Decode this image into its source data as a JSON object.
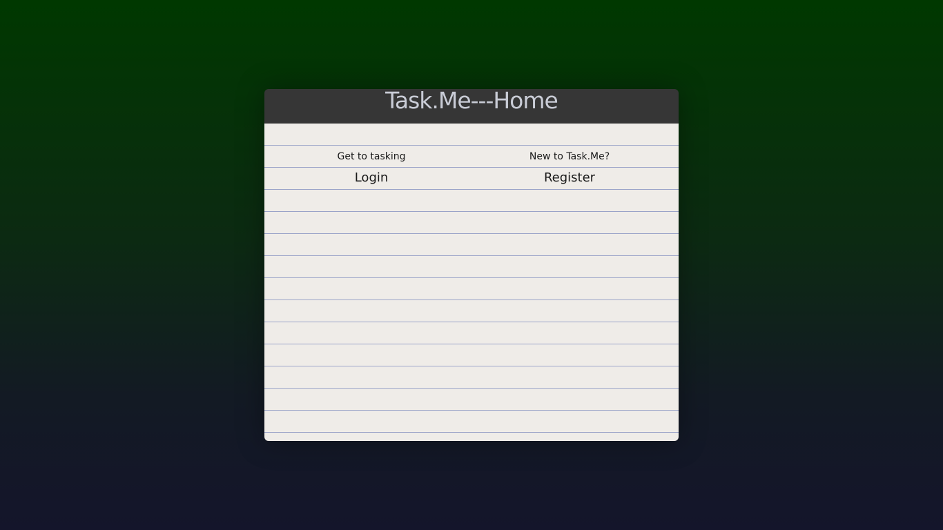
{
  "header": {
    "title": "Task.Me---Home"
  },
  "login_section": {
    "caption": "Get to tasking",
    "link_label": "Login"
  },
  "register_section": {
    "caption": "New to Task.Me?",
    "link_label": "Register"
  },
  "colors": {
    "page_gradient_top": "#003800",
    "page_gradient_bottom": "#14152b",
    "header_background": "#363636",
    "header_text": "#c9ccd6",
    "paper_background": "#efece8",
    "ruled_line": "#9aa3c8"
  }
}
